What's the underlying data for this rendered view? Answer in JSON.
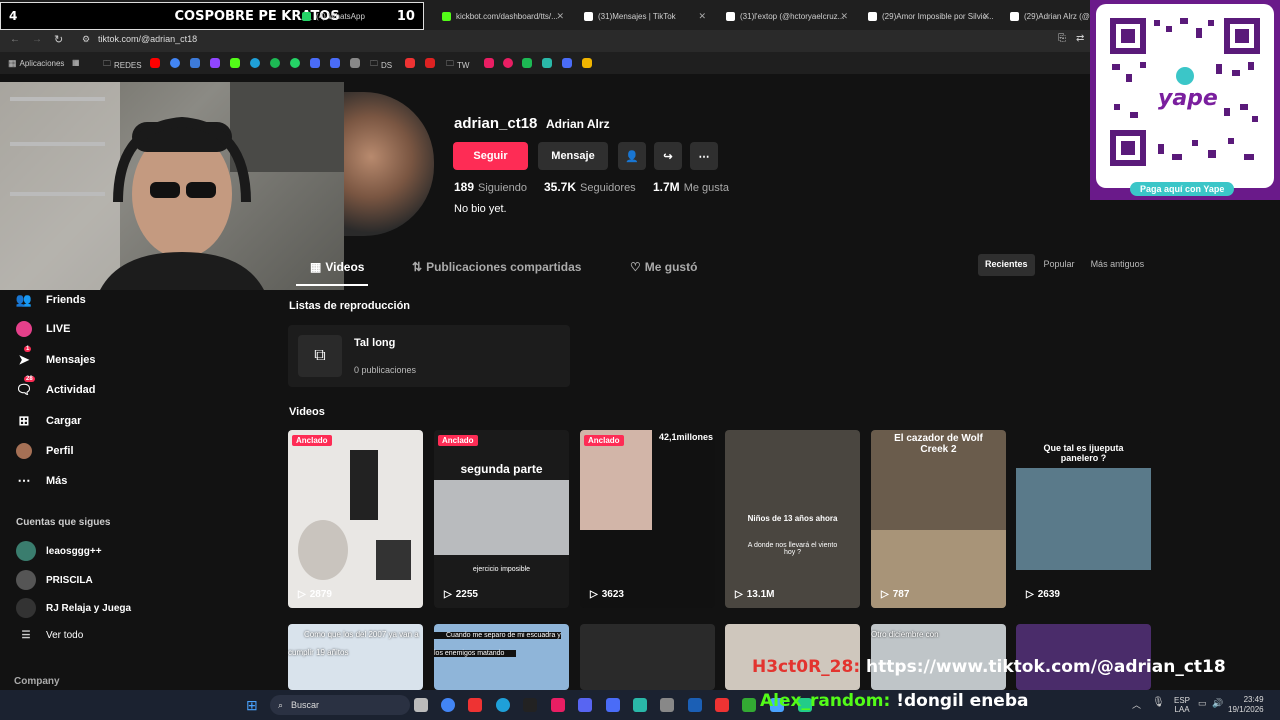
{
  "stream_banner": {
    "left": "4",
    "title": "COSPOBRE PE KRATOS",
    "right": "10"
  },
  "browser": {
    "tabs": [
      {
        "title": "(4) WhatsApp",
        "color": "#25d366"
      },
      {
        "title": "kickbot.com/dashboard/tts/...",
        "color": "#53fc18"
      },
      {
        "title": "(31)Mensajes | TikTok",
        "color": "#000000"
      },
      {
        "title": "(31)l'extop (@hctoryaelcruz...",
        "color": "#000000"
      },
      {
        "title": "(29)Amor Imposible por Silvio...",
        "color": "#000000"
      },
      {
        "title": "(29)Adrian Alrz (@ad...",
        "color": "#000000"
      }
    ],
    "url": "tiktok.com/@adrian_ct18",
    "bookmarks": [
      "Aplicaciones",
      "REDES",
      "DS",
      "TW"
    ]
  },
  "sidebar": {
    "items": [
      {
        "label": "Friends",
        "icon": "friends-icon"
      },
      {
        "label": "LIVE",
        "icon": "live-icon"
      },
      {
        "label": "Mensajes",
        "icon": "messages-icon",
        "badge": "1"
      },
      {
        "label": "Actividad",
        "icon": "activity-icon",
        "badge": "28"
      },
      {
        "label": "Cargar",
        "icon": "upload-icon"
      },
      {
        "label": "Perfil",
        "icon": "profile-icon"
      },
      {
        "label": "Más",
        "icon": "more-icon"
      }
    ],
    "following_title": "Cuentas que sigues",
    "following": [
      "leaosggg++",
      "PRISCILA",
      "RJ Relaja y Juega"
    ],
    "see_all": "Ver todo",
    "company": "Company"
  },
  "profile": {
    "username": "adrian_ct18",
    "nickname": "Adrian Alrz",
    "follow_button": "Seguir",
    "message_button": "Mensaje",
    "stats": [
      {
        "value": "189",
        "label": "Siguiendo"
      },
      {
        "value": "35.7K",
        "label": "Seguidores"
      },
      {
        "value": "1.7M",
        "label": "Me gusta"
      }
    ],
    "bio": "No bio yet."
  },
  "tabs": {
    "videos": "Videos",
    "shared": "Publicaciones compartidas",
    "liked": "Me gustó",
    "sort": [
      "Recientes",
      "Popular",
      "Más antiguos"
    ]
  },
  "playlists": {
    "title": "Listas de reproducción",
    "item_name": "Tal long",
    "item_count": "0 publicaciones"
  },
  "videos_title": "Videos",
  "videos": [
    {
      "views": "2879",
      "pinned": "Anclado",
      "caption": "",
      "bg": "#e9e7e4"
    },
    {
      "views": "2255",
      "pinned": "Anclado",
      "caption": "segunda parte",
      "sub": "ejercicio imposible",
      "bg": "#1a1a1a"
    },
    {
      "views": "3623",
      "pinned": "Anclado",
      "caption": "42,1millones",
      "bg": "#111111"
    },
    {
      "views": "13.1M",
      "pinned": "",
      "caption": "Niños de 13 años ahora",
      "sub": "A donde nos llevará el viento hoy ?",
      "bg": "#4a4640"
    },
    {
      "views": "787",
      "pinned": "",
      "caption": "El cazador de Wolf Creek 2",
      "bg": "#6a5c4c"
    },
    {
      "views": "2639",
      "pinned": "",
      "caption": "Que tal es ijueputa panelero ?",
      "bg": "#121212"
    }
  ],
  "videos_row2": [
    {
      "caption": "Como que los del 2007 ya van a cumplir 19 añitos",
      "bg": "#d9e3ec"
    },
    {
      "caption": "Cuando me separo de mi escuadra y los enemigos matando",
      "bg": "#8fb5d9"
    },
    {
      "caption": "",
      "bg": "#2a2a2a"
    },
    {
      "caption": "",
      "bg": "#cfc7bd"
    },
    {
      "caption": "Otro diciembre con",
      "bg": "#bfc5c8"
    },
    {
      "caption": "",
      "bg": "#4a2c6a"
    }
  ],
  "qr": {
    "brand": "yape",
    "cta": "Paga aquí con Yape"
  },
  "overlay": {
    "link_prefix": "H3ct0R_28:",
    "link": " https://www.tiktok.com/@adrian_ct18",
    "chat_user": "Alex_random:",
    "chat_msg": " !dongil eneba"
  },
  "taskbar": {
    "search": "Buscar",
    "lang": "ESP",
    "lang2": "LAA",
    "time": "23:49",
    "date": "19/1/2026"
  }
}
